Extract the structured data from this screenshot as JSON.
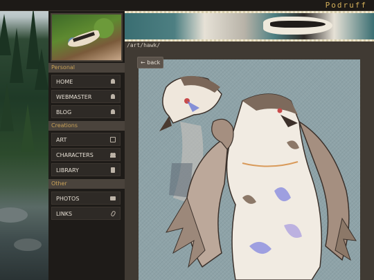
{
  "site": {
    "title": "Podruff"
  },
  "breadcrumb": "/art/hawk/",
  "back_button": {
    "label": "back",
    "icon": "arrow-left-icon"
  },
  "sidebar": {
    "sections": [
      {
        "heading": "Personal",
        "items": [
          {
            "label": "HOME",
            "icon": "bell-icon"
          },
          {
            "label": "WEBMASTER",
            "icon": "bell-icon"
          },
          {
            "label": "BLOG",
            "icon": "bell-icon"
          }
        ]
      },
      {
        "heading": "Creations",
        "items": [
          {
            "label": "ART",
            "icon": "image-icon"
          },
          {
            "label": "CHARACTERS",
            "icon": "users-icon"
          },
          {
            "label": "LIBRARY",
            "icon": "book-icon"
          }
        ]
      },
      {
        "heading": "Other",
        "items": [
          {
            "label": "PHOTOS",
            "icon": "camera-icon"
          },
          {
            "label": "LINKS",
            "icon": "paperclip-icon"
          }
        ]
      }
    ]
  },
  "colors": {
    "accent": "#c9a258",
    "title": "#d4b05a",
    "artwork_bg": "#8ea3a8"
  }
}
